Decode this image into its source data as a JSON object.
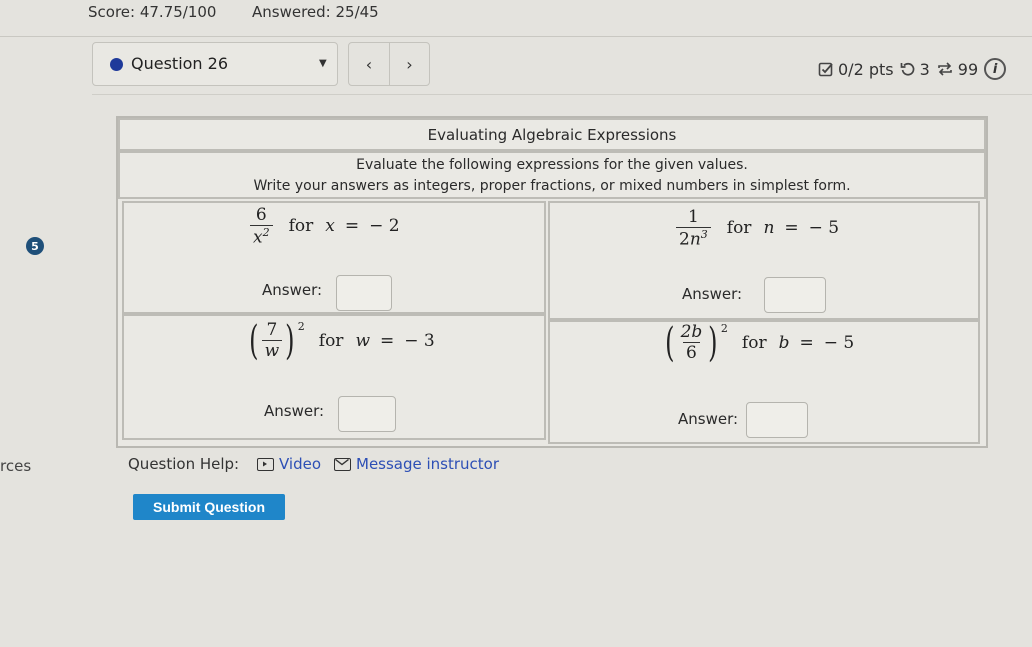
{
  "header": {
    "score": "Score: 47.75/100",
    "answered": "Answered: 25/45"
  },
  "question_nav": {
    "selected_question": "Question 26",
    "prev_icon": "‹",
    "next_icon": "›",
    "caret": "▼"
  },
  "stats": {
    "points": "0/2 pts",
    "retries": "3",
    "attempts": "99",
    "info": "i"
  },
  "step_badge": "5",
  "table": {
    "title": "Evaluating Algebraic Expressions",
    "instruction_line1": "Evaluate the following expressions for the given values.",
    "instruction_line2": "Write your answers as integers, proper fractions, or mixed numbers in simplest form.",
    "answer_label": "Answer:",
    "problems": [
      {
        "numerator": "6",
        "denominator_var": "x",
        "denominator_coef": "",
        "exponent": "2",
        "outer_exponent": "",
        "for": "for",
        "variable": "x",
        "value": "− 2",
        "answer": ""
      },
      {
        "numerator": "1",
        "denominator_var": "n",
        "denominator_coef": "2",
        "exponent": "3",
        "outer_exponent": "",
        "for": "for",
        "variable": "n",
        "value": "− 5",
        "answer": ""
      },
      {
        "numerator": "7",
        "denominator_var": "w",
        "denominator_coef": "",
        "exponent": "",
        "outer_exponent": "2",
        "for": "for",
        "variable": "w",
        "value": "− 3",
        "answer": ""
      },
      {
        "numerator": "2b",
        "denominator_var": "",
        "denominator_coef": "6",
        "exponent": "",
        "outer_exponent": "2",
        "for": "for",
        "variable": "b",
        "value": "− 5",
        "answer": ""
      }
    ]
  },
  "sidebar_fragment": "rces",
  "help": {
    "label": "Question Help:",
    "video": "Video",
    "message": "Message instructor"
  },
  "submit_label": "Submit Question"
}
